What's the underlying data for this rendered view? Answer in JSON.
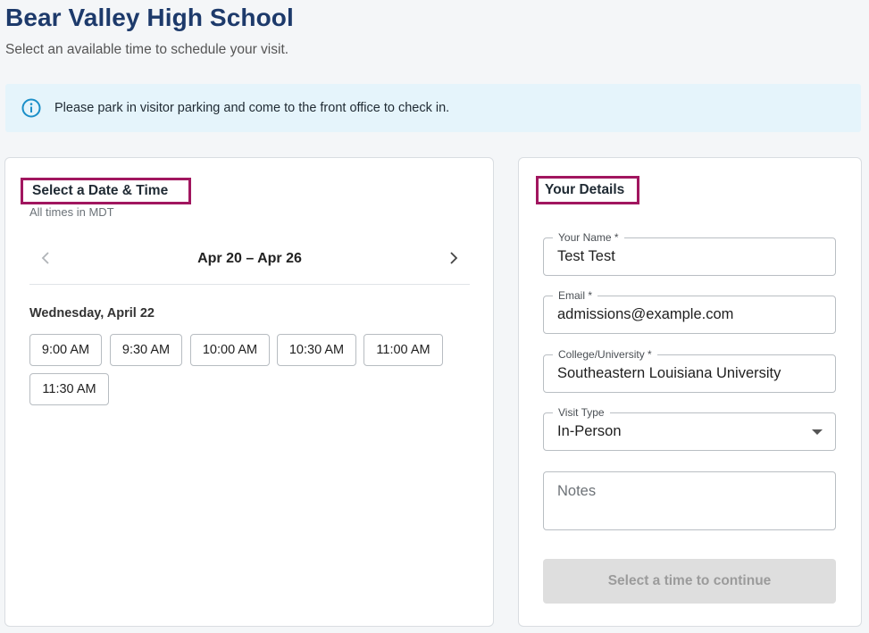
{
  "header": {
    "title": "Bear Valley High School",
    "subtitle": "Select an available time to schedule your visit."
  },
  "banner": {
    "icon": "info-icon",
    "text": "Please park in visitor parking and come to the front office to check in."
  },
  "schedule": {
    "heading": "Select a Date & Time",
    "timezone_note": "All times in MDT",
    "week_range": "Apr 20 – Apr 26",
    "day_label": "Wednesday, April 22",
    "slots": [
      "9:00 AM",
      "9:30 AM",
      "10:00 AM",
      "10:30 AM",
      "11:00 AM",
      "11:30 AM"
    ]
  },
  "details": {
    "heading": "Your Details",
    "name": {
      "label": "Your Name *",
      "value": "Test Test"
    },
    "email": {
      "label": "Email *",
      "value": "admissions@example.com"
    },
    "college": {
      "label": "College/University *",
      "value": "Southeastern Louisiana University"
    },
    "visit_type": {
      "label": "Visit Type",
      "value": "In-Person"
    },
    "notes": {
      "placeholder": "Notes"
    },
    "continue_label": "Select a time to continue"
  },
  "colors": {
    "title": "#1d3a6b",
    "highlight": "#a1165f",
    "banner_bg": "#e5f4fb",
    "info_icon": "#1b8fc8"
  }
}
